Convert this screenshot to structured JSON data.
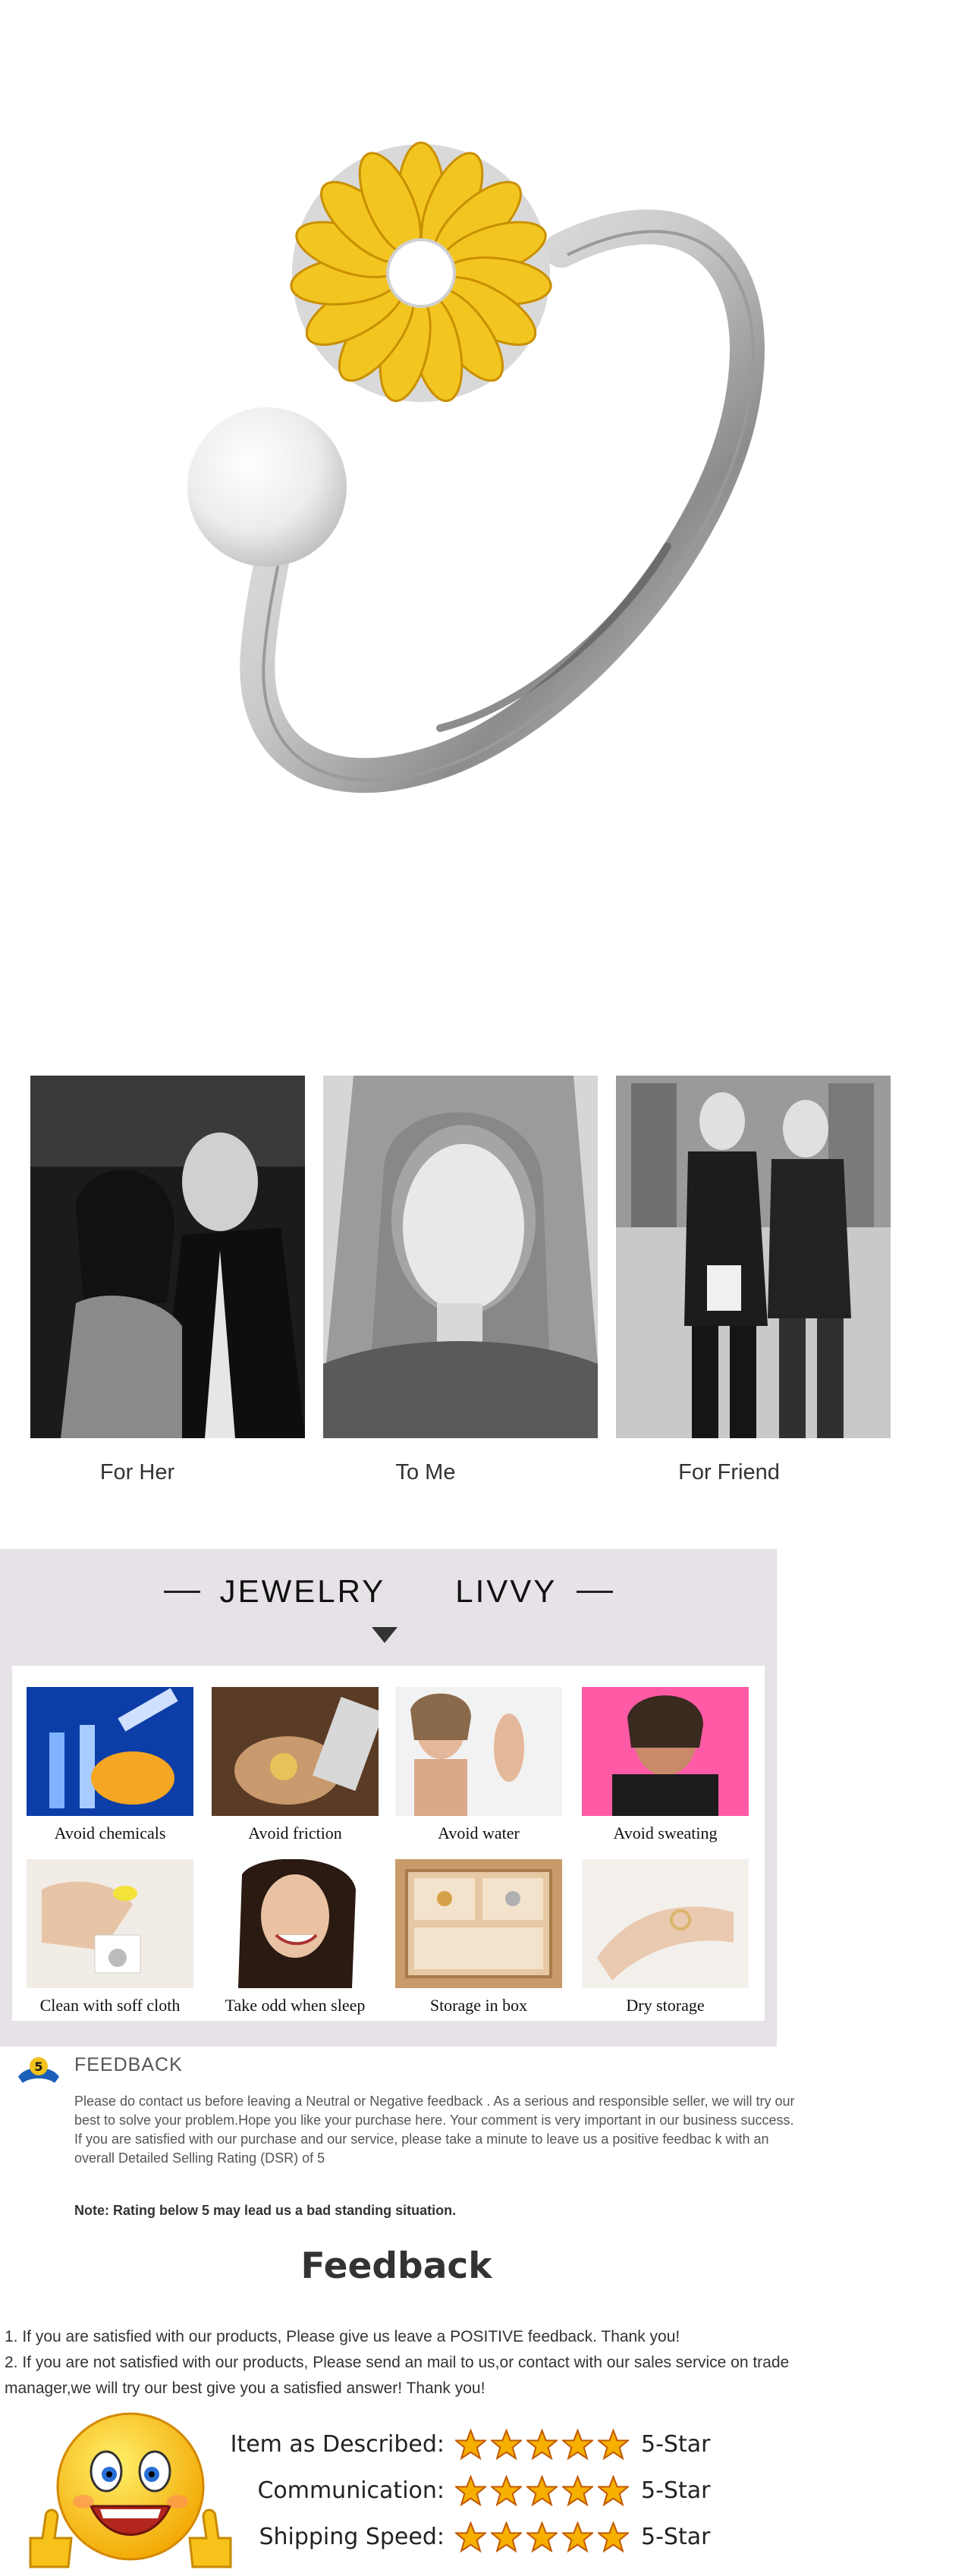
{
  "gifts": {
    "items": [
      {
        "label": "For Her"
      },
      {
        "label": "To Me"
      },
      {
        "label": "For Friend"
      }
    ]
  },
  "care": {
    "brand_left": "JEWELRY",
    "brand_right": "LIVVY",
    "tips": [
      {
        "label": "Avoid chemicals"
      },
      {
        "label": "Avoid friction"
      },
      {
        "label": "Avoid water"
      },
      {
        "label": "Avoid sweating"
      },
      {
        "label": "Clean with soff cloth"
      },
      {
        "label": "Take odd when sleep"
      },
      {
        "label": "Storage in box"
      },
      {
        "label": "Dry storage"
      }
    ]
  },
  "notice": {
    "heading": "FEEDBACK",
    "paragraph1": "Please do contact us before leaving a Neutral or Negative  feedback . As a serious and responsible seller, we will try our best to solve your problem.Hope you like your purchase here. Your comment is very important in our business success.",
    "paragraph2": " If you are satisfied with our purchase and our service,  please take a minute to leave us  a positive feedbac k with an overall  Detailed Selling Rating (DSR) of 5",
    "note": "Note: Rating below 5 may lead us a bad standing situation.",
    "logo_text": "5"
  },
  "feedback": {
    "title": "Feedback",
    "line1": "1. If you are satisfied with our products, Please give us leave a POSITIVE feedback. Thank you!",
    "line2": "2. If you are not satisfied with our products, Please send an mail to us,or contact with our sales service on trade manager,we will try our best give you a satisfied answer! Thank you!",
    "ratings": [
      {
        "label": "Item as Described:",
        "stars": 5,
        "value": "5-Star"
      },
      {
        "label": "Communication:",
        "stars": 5,
        "value": "5-Star"
      },
      {
        "label": "Shipping Speed:",
        "stars": 5,
        "value": "5-Star"
      }
    ]
  },
  "colors": {
    "petal": "#f2c520",
    "star": "#f5a800",
    "panel": "#e6e2e7"
  }
}
